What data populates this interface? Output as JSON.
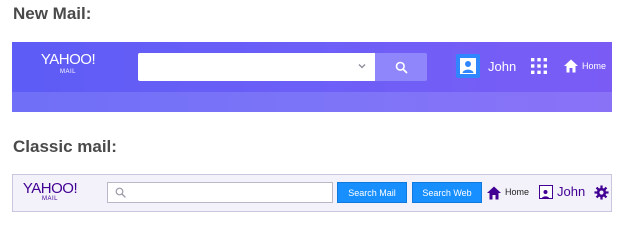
{
  "sections": {
    "new_title": "New Mail:",
    "classic_title": "Classic mail:"
  },
  "new_mail": {
    "logo_wordmark": "YAHOO!",
    "logo_sub": "MAIL",
    "search": {
      "value": "",
      "placeholder": ""
    },
    "user_name": "John",
    "home_label": "Home",
    "colors": {
      "bar_start": "#5d5cf6",
      "bar_end": "#7a5cf5",
      "search_button": "#8f86fb",
      "avatar": "#2f86ff"
    },
    "icons": [
      "chevron-down-icon",
      "search-icon",
      "avatar-icon",
      "apps-grid-icon",
      "home-icon"
    ]
  },
  "classic_mail": {
    "logo_wordmark": "YAHOO!",
    "logo_sub": "MAIL",
    "search": {
      "value": "",
      "placeholder": ""
    },
    "search_mail_label": "Search Mail",
    "search_web_label": "Search Web",
    "home_label": "Home",
    "user_name": "John",
    "colors": {
      "bar_bg": "#f3f2fa",
      "button": "#188fff",
      "brand_purple": "#410093"
    },
    "icons": [
      "search-icon",
      "home-icon",
      "avatar-icon",
      "gear-icon"
    ]
  }
}
